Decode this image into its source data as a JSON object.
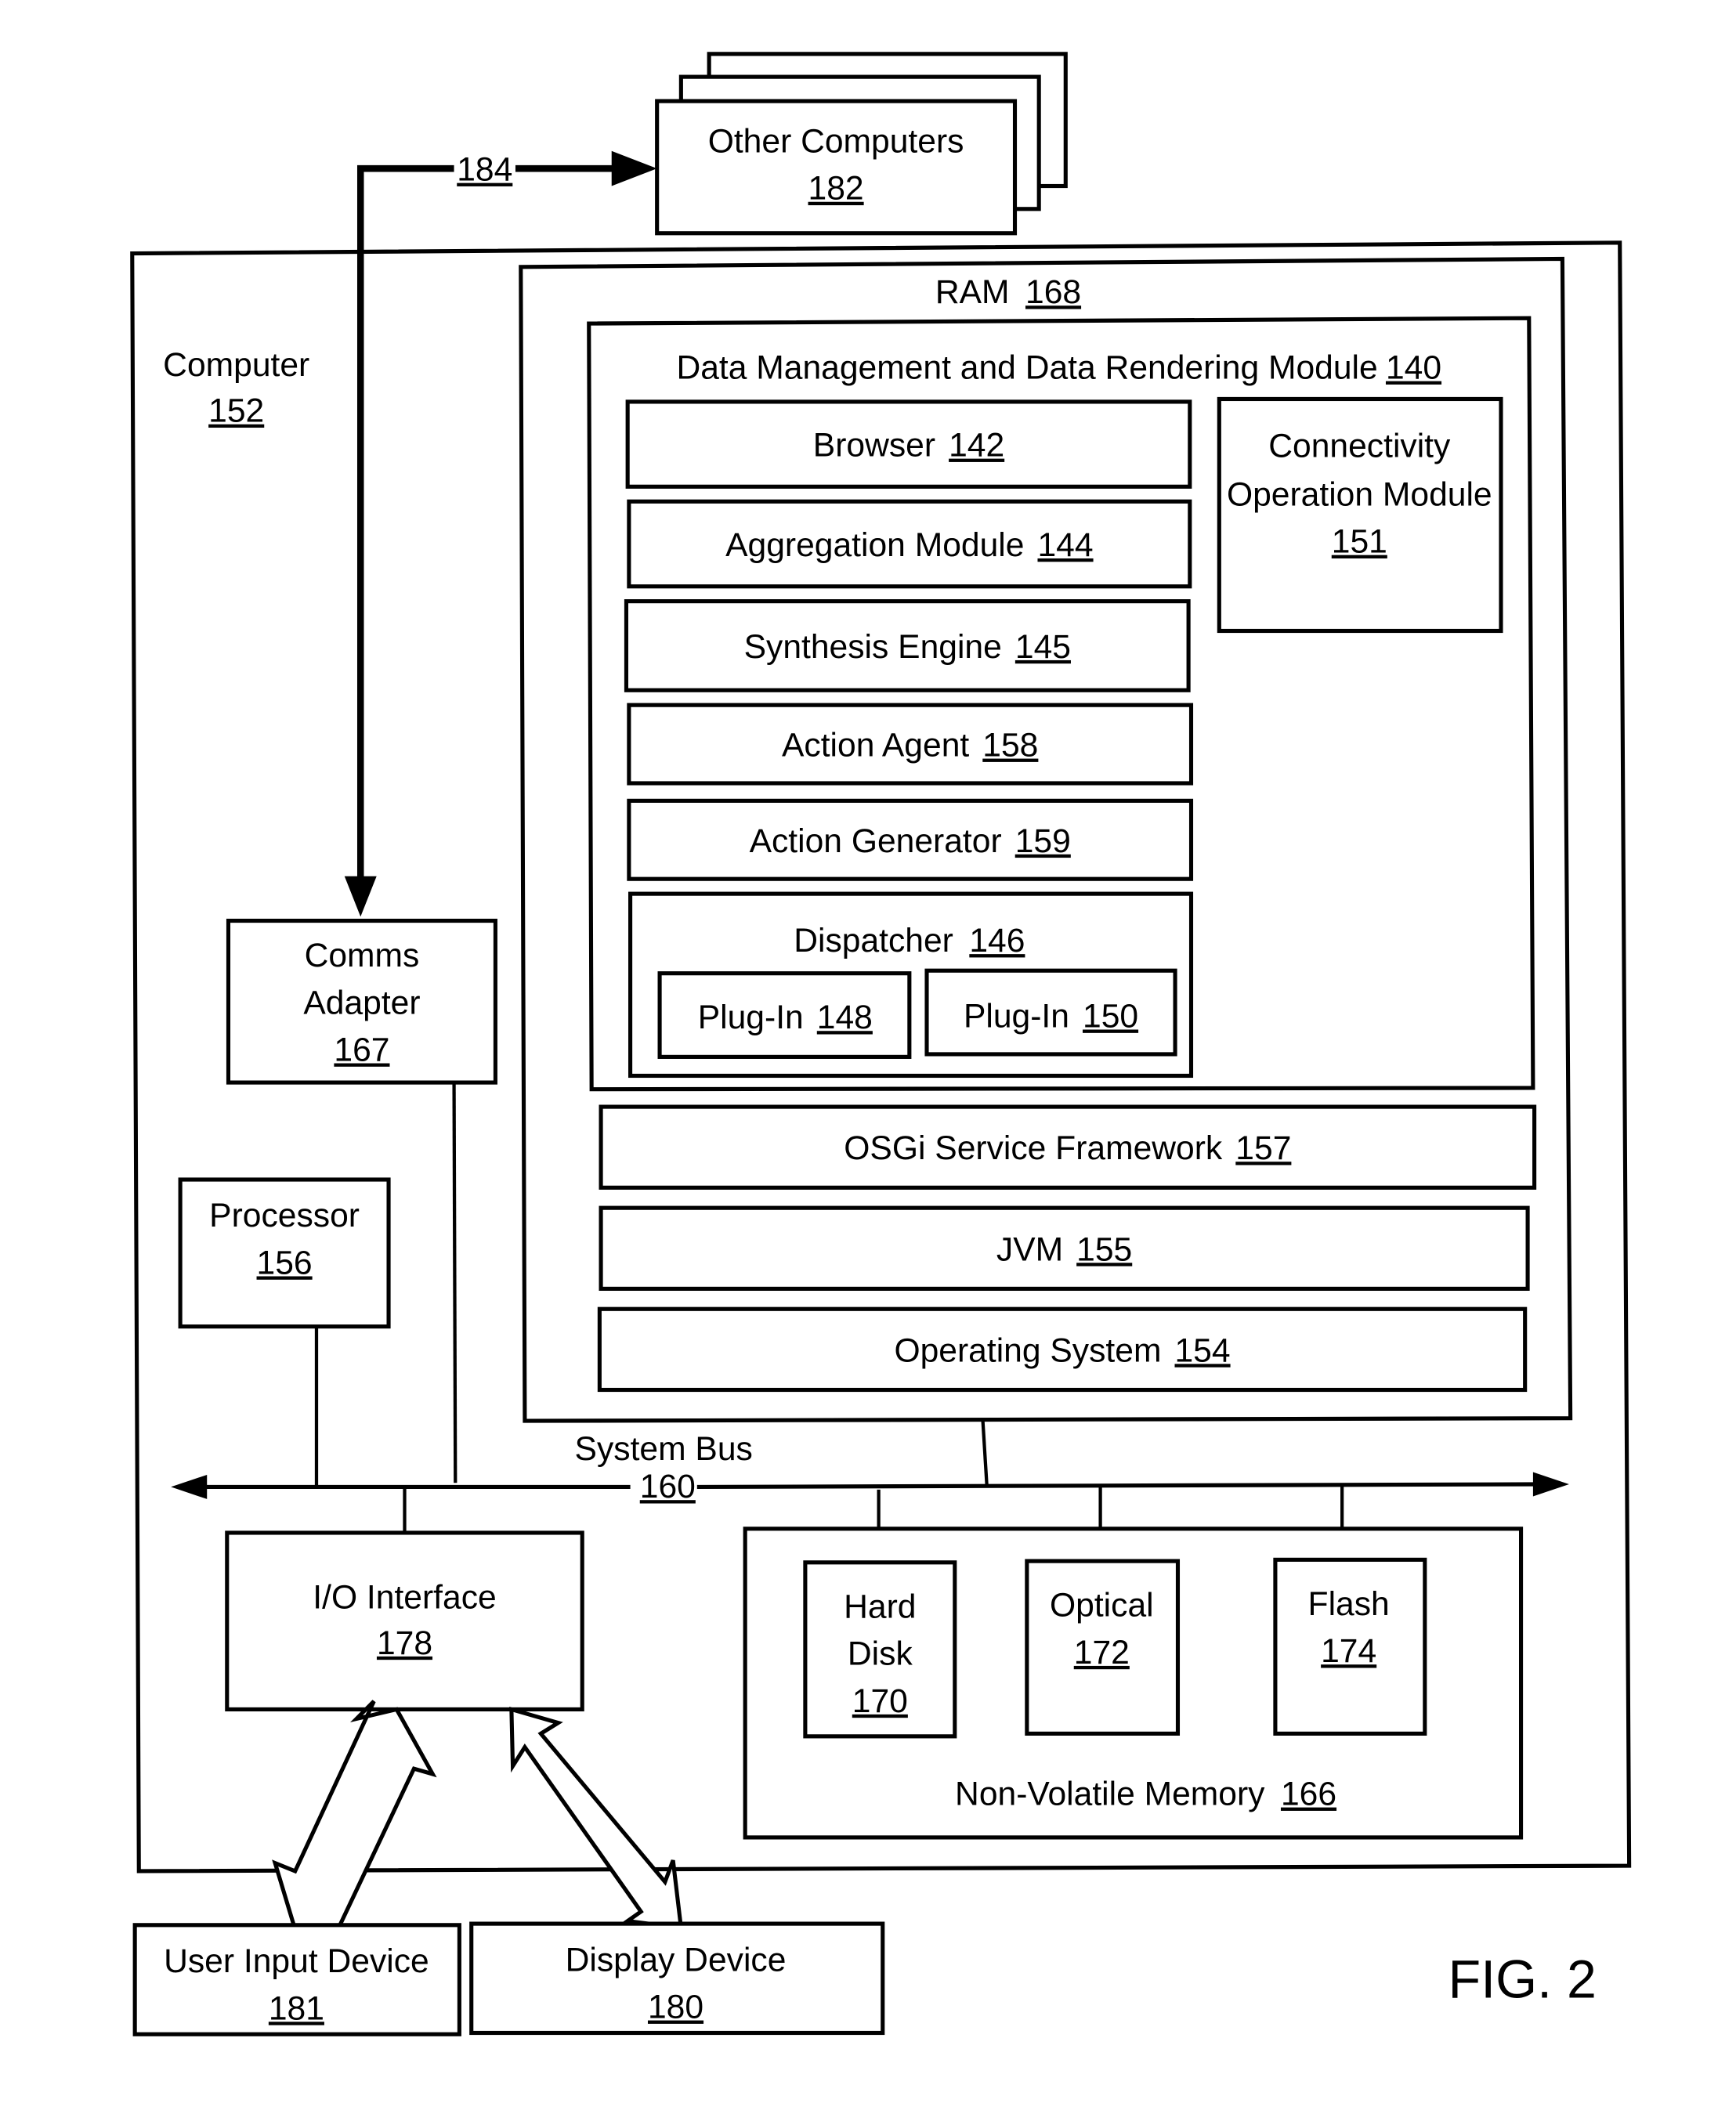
{
  "figure_label": "FIG. 2",
  "network": {
    "ref": "184"
  },
  "other_computers": {
    "label": "Other Computers",
    "ref": "182"
  },
  "computer": {
    "label": "Computer",
    "ref": "152"
  },
  "ram": {
    "label": "RAM",
    "ref": "168"
  },
  "dm_module": {
    "label": "Data Management and Data Rendering Module",
    "ref": "140",
    "components": [
      {
        "label": "Browser",
        "ref": "142"
      },
      {
        "label": "Aggregation Module",
        "ref": "144"
      },
      {
        "label": "Synthesis Engine",
        "ref": "145"
      },
      {
        "label": "Action Agent",
        "ref": "158"
      },
      {
        "label": "Action Generator",
        "ref": "159"
      }
    ],
    "dispatcher": {
      "label": "Dispatcher",
      "ref": "146",
      "plugins": [
        {
          "label": "Plug-In",
          "ref": "148"
        },
        {
          "label": "Plug-In",
          "ref": "150"
        }
      ]
    },
    "connectivity": {
      "line1": "Connectivity",
      "line2": "Operation Module",
      "ref": "151"
    }
  },
  "ram_layers": [
    {
      "label": "OSGi Service Framework",
      "ref": "157"
    },
    {
      "label": "JVM",
      "ref": "155"
    },
    {
      "label": "Operating System",
      "ref": "154"
    }
  ],
  "comms_adapter": {
    "line1": "Comms",
    "line2": "Adapter",
    "ref": "167"
  },
  "processor": {
    "label": "Processor",
    "ref": "156"
  },
  "system_bus": {
    "label": "System Bus",
    "ref": "160"
  },
  "io_interface": {
    "label": "I/O Interface",
    "ref": "178"
  },
  "non_volatile_memory": {
    "label": "Non-Volatile Memory",
    "ref": "166",
    "devices": [
      {
        "line1": "Hard",
        "line2": "Disk",
        "ref": "170"
      },
      {
        "line1": "Optical",
        "line2": "",
        "ref": "172"
      },
      {
        "line1": "Flash",
        "line2": "",
        "ref": "174"
      }
    ]
  },
  "user_input_device": {
    "label": "User Input Device",
    "ref": "181"
  },
  "display_device": {
    "label": "Display Device",
    "ref": "180"
  }
}
